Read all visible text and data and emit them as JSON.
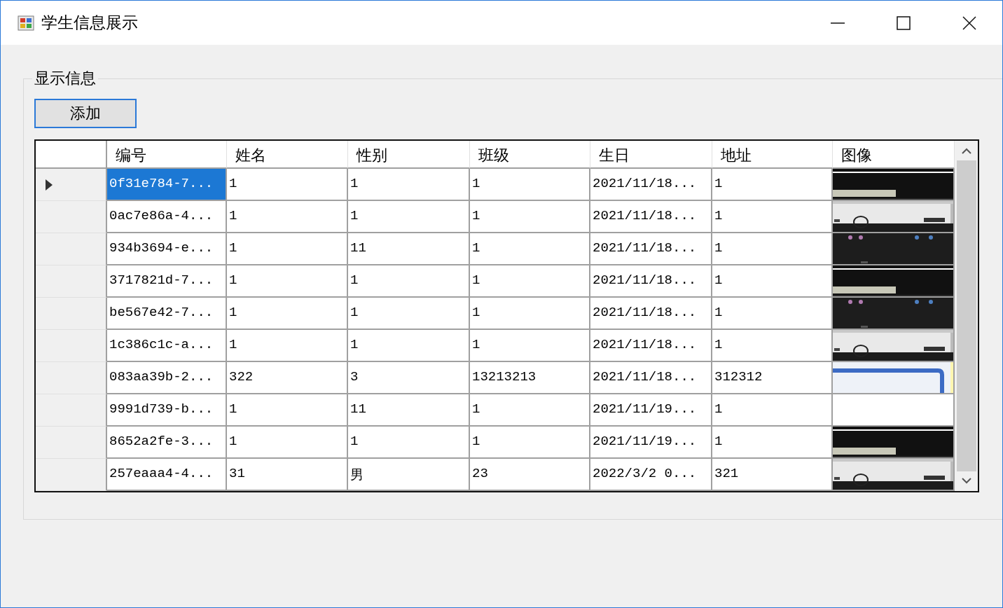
{
  "window": {
    "title": "学生信息展示"
  },
  "group": {
    "label": "显示信息"
  },
  "add_button": {
    "label": "添加"
  },
  "table": {
    "columns": [
      "编号",
      "姓名",
      "性别",
      "班级",
      "生日",
      "地址",
      "图像"
    ],
    "rows": [
      {
        "selected": true,
        "cells": [
          "0f31e784-7...",
          "1",
          "1",
          "1",
          "2021/11/18...",
          "1"
        ],
        "image": {
          "kind": "picture"
        }
      },
      {
        "selected": false,
        "cells": [
          "0ac7e86a-4...",
          "1",
          "1",
          "1",
          "2021/11/18...",
          "1"
        ],
        "image": {
          "kind": "picture"
        }
      },
      {
        "selected": false,
        "cells": [
          "934b3694-e...",
          "1",
          "11",
          "1",
          "2021/11/18...",
          "1"
        ],
        "image": {
          "kind": "picture"
        }
      },
      {
        "selected": false,
        "cells": [
          "3717821d-7...",
          "1",
          "1",
          "1",
          "2021/11/18...",
          "1"
        ],
        "image": {
          "kind": "picture"
        }
      },
      {
        "selected": false,
        "cells": [
          "be567e42-7...",
          "1",
          "1",
          "1",
          "2021/11/18...",
          "1"
        ],
        "image": {
          "kind": "picture"
        }
      },
      {
        "selected": false,
        "cells": [
          "1c386c1c-a...",
          "1",
          "1",
          "1",
          "2021/11/18...",
          "1"
        ],
        "image": {
          "kind": "picture"
        }
      },
      {
        "selected": false,
        "cells": [
          "083aa39b-2...",
          "322",
          "3",
          "13213213",
          "2021/11/18...",
          "312312"
        ],
        "image": {
          "kind": "picture"
        }
      },
      {
        "selected": false,
        "cells": [
          "9991d739-b...",
          "1",
          "11",
          "1",
          "2021/11/19...",
          "1"
        ]
      },
      {
        "selected": false,
        "cells": [
          "8652a2fe-3...",
          "1",
          "1",
          "1",
          "2021/11/19...",
          "1"
        ],
        "image": {
          "kind": "picture"
        }
      },
      {
        "selected": false,
        "cells": [
          "257eaaa4-4...",
          "31",
          "男",
          "23",
          "2022/3/2 0...",
          "321"
        ],
        "image": {
          "kind": "picture"
        }
      }
    ]
  }
}
